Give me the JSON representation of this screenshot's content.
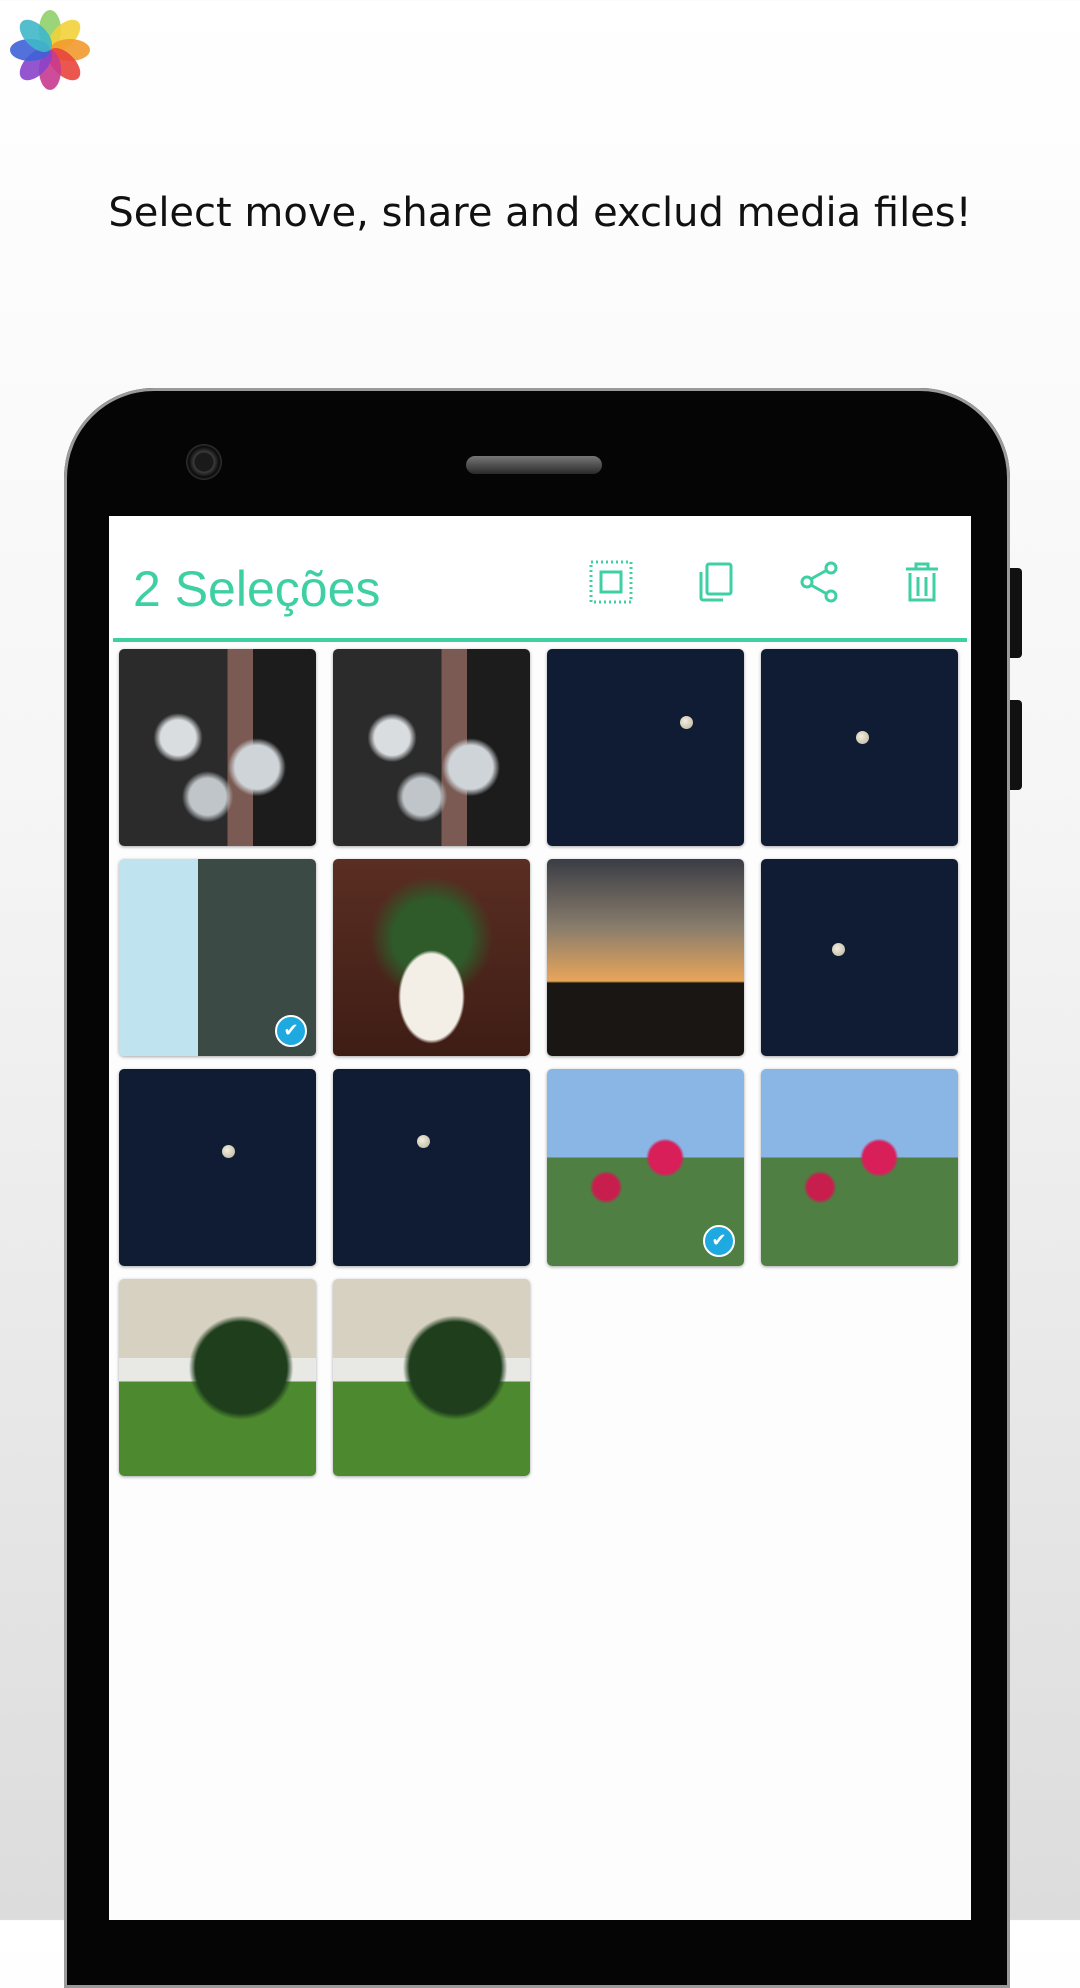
{
  "headline": "Select move, share and exclud media files!",
  "app_bar": {
    "title": "2 Seleções",
    "accent_color": "#3ecfa3",
    "actions": [
      {
        "name": "select-all-icon"
      },
      {
        "name": "copy-icon"
      },
      {
        "name": "share-icon"
      },
      {
        "name": "delete-icon"
      }
    ]
  },
  "grid": {
    "columns": 4,
    "photos": [
      {
        "name": "photo-glassware-1",
        "subject": "glassware",
        "selected": false
      },
      {
        "name": "photo-glassware-2",
        "subject": "glassware",
        "selected": false
      },
      {
        "name": "photo-moon-1",
        "subject": "moon",
        "selected": false
      },
      {
        "name": "photo-moon-2",
        "subject": "moon",
        "selected": false
      },
      {
        "name": "photo-wall-lamp",
        "subject": "wall",
        "selected": true
      },
      {
        "name": "photo-potted-plant",
        "subject": "pot",
        "selected": false
      },
      {
        "name": "photo-sunset",
        "subject": "sunset",
        "selected": false
      },
      {
        "name": "photo-moon-3",
        "subject": "moon",
        "selected": false
      },
      {
        "name": "photo-moon-4",
        "subject": "moon",
        "selected": false
      },
      {
        "name": "photo-moon-5",
        "subject": "moon",
        "selected": false
      },
      {
        "name": "photo-flowers-1",
        "subject": "flowers",
        "selected": true
      },
      {
        "name": "photo-flowers-2",
        "subject": "flowers",
        "selected": false
      },
      {
        "name": "photo-garden-plant-1",
        "subject": "garden",
        "selected": false
      },
      {
        "name": "photo-garden-plant-2",
        "subject": "garden",
        "selected": false
      }
    ],
    "selection_color": "#1fa9e1"
  }
}
